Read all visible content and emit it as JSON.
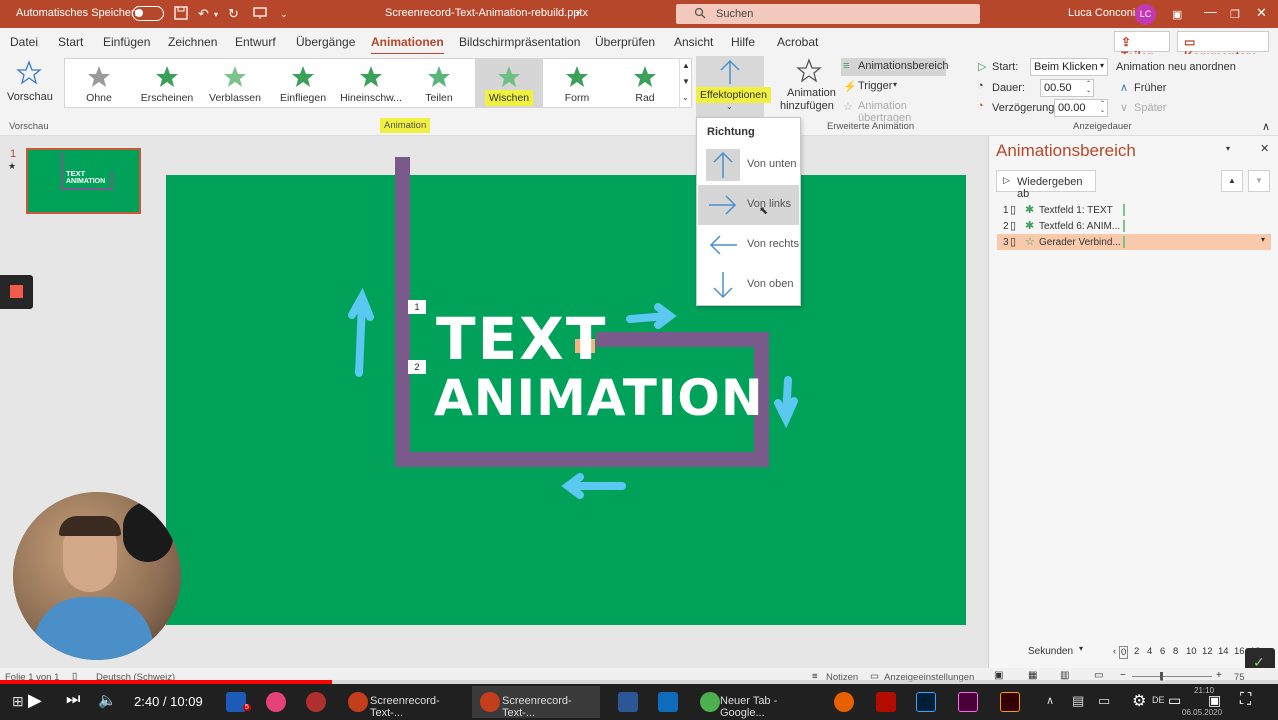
{
  "titlebar": {
    "autosave_label": "Automatisches Speichern",
    "document_title": "Screenrecord-Text-Animation-rebuild.pptx",
    "search_placeholder": "Suchen",
    "user_name": "Luca Conconi",
    "user_initials": "LC"
  },
  "menu": {
    "items": [
      "Datei",
      "Start",
      "Einfügen",
      "Zeichnen",
      "Entwurf",
      "Übergänge",
      "Animationen",
      "Bildschirmpräsentation",
      "Überprüfen",
      "Ansicht",
      "Hilfe",
      "Acrobat"
    ],
    "active": "Animationen",
    "share_label": "Teilen",
    "comments_label": "Kommentare"
  },
  "ribbon": {
    "preview_label": "Vorschau",
    "preview_group": "Vorschau",
    "effects": [
      "Ohne",
      "Erscheinen",
      "Verblassen",
      "Einfliegen",
      "Hineinschw...",
      "Teilen",
      "Wischen",
      "Form",
      "Rad"
    ],
    "selected_effect": "Wischen",
    "animation_group": "Animation",
    "effect_options_label": "Effektoptionen",
    "add_animation_label_1": "Animation",
    "add_animation_label_2": "hinzufügen",
    "animation_pane_button": "Animationsbereich",
    "trigger_label": "Trigger",
    "animation_painter_label": "Animation übertragen",
    "advanced_group": "Erweiterte Animation",
    "start_label": "Start:",
    "start_value": "Beim Klicken",
    "duration_label": "Dauer:",
    "duration_value": "00.50",
    "delay_label": "Verzögerung:",
    "delay_value": "00.00",
    "timing_group": "Anzeigedauer",
    "reorder_label": "Animation neu anordnen",
    "earlier_label": "Früher",
    "later_label": "Später"
  },
  "dropdown": {
    "title": "Richtung",
    "items": [
      "Von unten",
      "Von links",
      "Von rechts",
      "Von oben"
    ],
    "hovered": "Von links"
  },
  "slide": {
    "number": "1",
    "line1": "TEXT",
    "line2": "ANIMATION",
    "tag1": "1",
    "tag2": "2",
    "tag3": "3",
    "thumb_line1": "TEXT",
    "thumb_line2": "ANIMATION",
    "color": "#00a25a",
    "path_color": "#7a5a8a"
  },
  "anim_pane": {
    "title": "Animationsbereich",
    "play_from": "Wiedergeben ab",
    "items": [
      {
        "num": "1",
        "label": "Textfeld 1: TEXT"
      },
      {
        "num": "2",
        "label": "Textfeld 6: ANIM..."
      },
      {
        "num": "3",
        "label": "Gerader Verbind..."
      }
    ],
    "seconds_label": "Sekunden",
    "timeline": [
      "0",
      "2",
      "4",
      "6",
      "8",
      "10",
      "12",
      "14",
      "16",
      "18"
    ]
  },
  "statusbar": {
    "slide_info": "Folie 1 von 1",
    "language": "Deutsch (Schweiz)",
    "notes_label": "Notizen",
    "display_settings": "Anzeigeeinstellungen",
    "zoom": "75"
  },
  "video": {
    "time": "2:40 / 10:09",
    "progress": 0.26
  },
  "taskbar": {
    "item_ppt1": "Screenrecord-Text-...",
    "item_ppt2": "Screenrecord-Text-...",
    "item_chrome": "Neuer Tab - Google...",
    "lang": "DE",
    "clock_time": "21:10",
    "clock_date": "06.05.2020",
    "mail_badge": "5"
  }
}
